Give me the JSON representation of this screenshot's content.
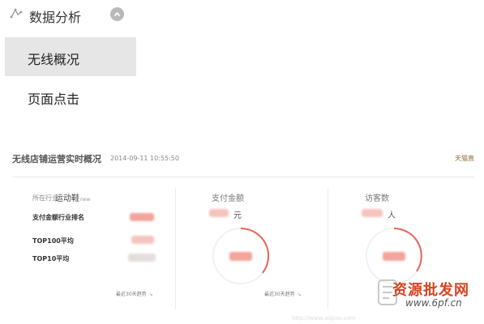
{
  "nav": {
    "section_title": "数据分析",
    "section_icon": "trend-icon",
    "collapse_icon": "chevron-up-icon",
    "items": [
      {
        "label": "无线概况",
        "active": true
      },
      {
        "label": "页面点击",
        "active": false
      }
    ]
  },
  "panel": {
    "title": "无线店铺运营实时概况",
    "timestamp": "2014-09-11  10:55:50",
    "link_label": "天猫直",
    "industry": {
      "label": "所在行业",
      "value": "运动鞋",
      "value_suffix": "new"
    },
    "rows": [
      {
        "label": "支付金额行业排名"
      },
      {
        "label": "TOP100平均"
      },
      {
        "label": "TOP10平均"
      }
    ],
    "trend_label": "最近30天趋势",
    "metrics": [
      {
        "label": "支付金额",
        "unit": "元",
        "trend_label": "最近30天趋势"
      },
      {
        "label": "访客数",
        "unit": "人"
      }
    ]
  },
  "watermark": {
    "brand": "资源批发网",
    "url": "www.6pf.cn",
    "faint": "http://www.aiqiao.com"
  },
  "colors": {
    "accent": "#e9635a",
    "active_nav_bg": "#e6e6e6"
  }
}
